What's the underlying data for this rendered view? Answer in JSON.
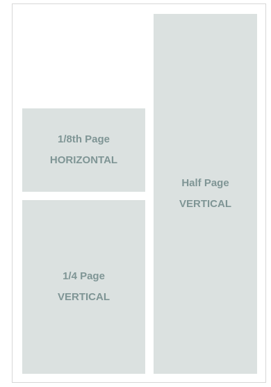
{
  "ad_sizes": {
    "eighth": {
      "size_label": "1/8th Page",
      "orientation_label": "HORIZONTAL"
    },
    "quarter": {
      "size_label": "1/4 Page",
      "orientation_label": "VERTICAL"
    },
    "half": {
      "size_label": "Half Page",
      "orientation_label": "VERTICAL"
    }
  },
  "colors": {
    "block_fill": "#dbe1e0",
    "label_text": "#7f9595",
    "frame_border": "#d7d7d7"
  }
}
